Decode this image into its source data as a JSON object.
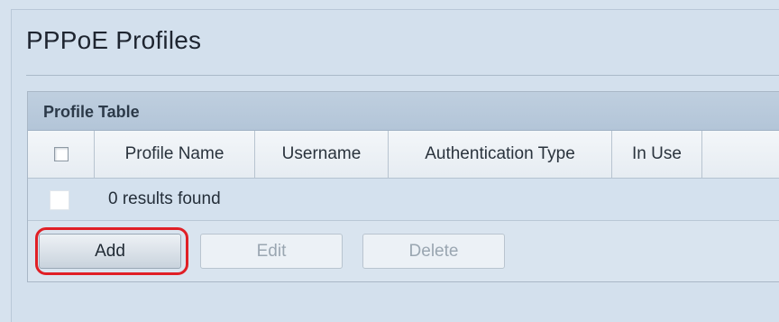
{
  "page": {
    "title": "PPPoE Profiles"
  },
  "table": {
    "title": "Profile Table",
    "columns": [
      "Profile Name",
      "Username",
      "Authentication Type",
      "In Use"
    ],
    "empty_message": "0 results found"
  },
  "buttons": {
    "add": "Add",
    "edit": "Edit",
    "delete": "Delete"
  },
  "colors": {
    "highlight": "#e01f26",
    "background": "#d6e2ee"
  }
}
